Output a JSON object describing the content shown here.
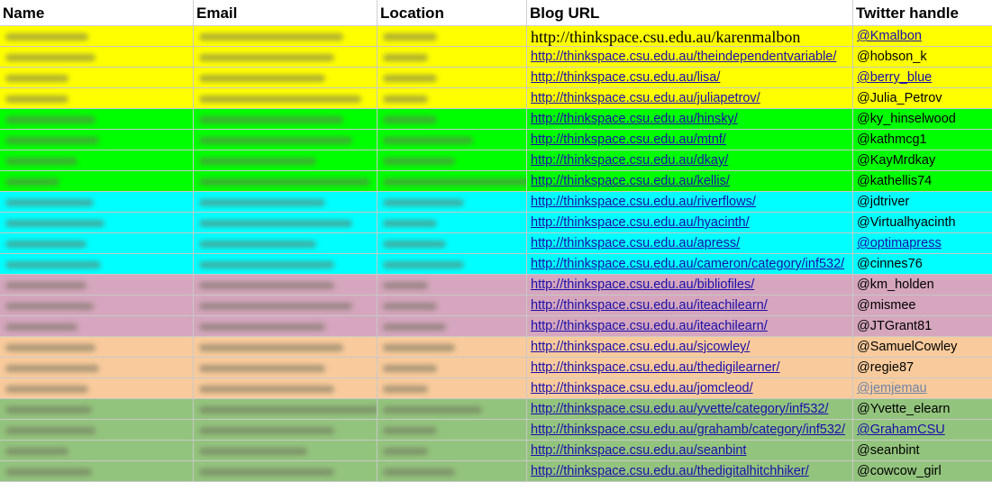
{
  "headers": [
    "Name",
    "Email",
    "Location",
    "Blog URL",
    "Twitter handle"
  ],
  "colors": {
    "yellow": "#ffff00",
    "green": "#00ff00",
    "cyan": "#00ffff",
    "mauve": "#d5a6bd",
    "peach": "#f9cb9c",
    "sage": "#93c47d"
  },
  "rows": [
    {
      "color": "#ffff00",
      "blog": "http://thinkspace.csu.edu.au/karenmalbon",
      "handle": "@Kmalbon",
      "handle_style": "link",
      "blog_style": "serif"
    },
    {
      "color": "#ffff00",
      "blog": "http://thinkspace.csu.edu.au/theindependentvariable/",
      "handle": "@hobson_k",
      "handle_style": "plain"
    },
    {
      "color": "#ffff00",
      "blog": "http://thinkspace.csu.edu.au/lisa/",
      "handle": "@berry_blue",
      "handle_style": "link"
    },
    {
      "color": "#ffff00",
      "blog": "http://thinkspace.csu.edu.au/juliapetrov/",
      "handle": "@Julia_Petrov",
      "handle_style": "plain"
    },
    {
      "color": "#00ff00",
      "blog": "http://thinkspace.csu.edu.au/hinsky/",
      "handle": "@ky_hinselwood",
      "handle_style": "plain"
    },
    {
      "color": "#00ff00",
      "blog": "http://thinkspace.csu.edu.au/mtnf/",
      "handle": "@kathmcg1",
      "handle_style": "plain"
    },
    {
      "color": "#00ff00",
      "blog": "http://thinkspace.csu.edu.au/dkay/",
      "handle": "@KayMrdkay",
      "handle_style": "plain"
    },
    {
      "color": "#00ff00",
      "blog": "http://thinkspace.csu.edu.au/kellis/",
      "handle": "@kathellis74",
      "handle_style": "plain"
    },
    {
      "color": "#00ffff",
      "blog": "http://thinkspace.csu.edu.au/riverflows/",
      "handle": "@jdtriver",
      "handle_style": "plain"
    },
    {
      "color": "#00ffff",
      "blog": "http://thinkspace.csu.edu.au/hyacinth/",
      "handle": "@Virtualhyacinth",
      "handle_style": "plain"
    },
    {
      "color": "#00ffff",
      "blog": "http://thinkspace.csu.edu.au/apress/",
      "handle": "@optimapress",
      "handle_style": "link"
    },
    {
      "color": "#00ffff",
      "blog": "http://thinkspace.csu.edu.au/cameron/category/inf532/",
      "handle": "@cinnes76",
      "handle_style": "plain"
    },
    {
      "color": "#d5a6bd",
      "blog": "http://thinkspace.csu.edu.au/bibliofiles/",
      "handle": "@km_holden",
      "handle_style": "plain"
    },
    {
      "color": "#d5a6bd",
      "blog": "http://thinkspace.csu.edu.au/iteachilearn/",
      "handle": "@mismee",
      "handle_style": "plain"
    },
    {
      "color": "#d5a6bd",
      "blog": "http://thinkspace.csu.edu.au/iteachilearn/",
      "handle": "@JTGrant81",
      "handle_style": "plain"
    },
    {
      "color": "#f9cb9c",
      "blog": "http://thinkspace.csu.edu.au/sjcowley/",
      "handle": "@SamuelCowley",
      "handle_style": "plain"
    },
    {
      "color": "#f9cb9c",
      "blog": "http://thinkspace.csu.edu.au/thedigilearner/",
      "handle": "@regie87",
      "handle_style": "plain"
    },
    {
      "color": "#f9cb9c",
      "blog": "http://thinkspace.csu.edu.au/jomcleod/",
      "handle": "@jemjemau",
      "handle_style": "faded"
    },
    {
      "color": "#93c47d",
      "blog": "http://thinkspace.csu.edu.au/yvette/category/inf532/",
      "handle": "@Yvette_elearn",
      "handle_style": "plain"
    },
    {
      "color": "#93c47d",
      "blog": "http://thinkspace.csu.edu.au/grahamb/category/inf532/",
      "handle": "@GrahamCSU",
      "handle_style": "link"
    },
    {
      "color": "#93c47d",
      "blog": "http://thinkspace.csu.edu.au/seanbint",
      "handle": "@seanbint",
      "handle_style": "plain"
    },
    {
      "color": "#93c47d",
      "blog": "http://thinkspace.csu.edu.au/thedigitalhitchhiker/",
      "handle": "@cowcow_girl",
      "handle_style": "plain"
    }
  ]
}
